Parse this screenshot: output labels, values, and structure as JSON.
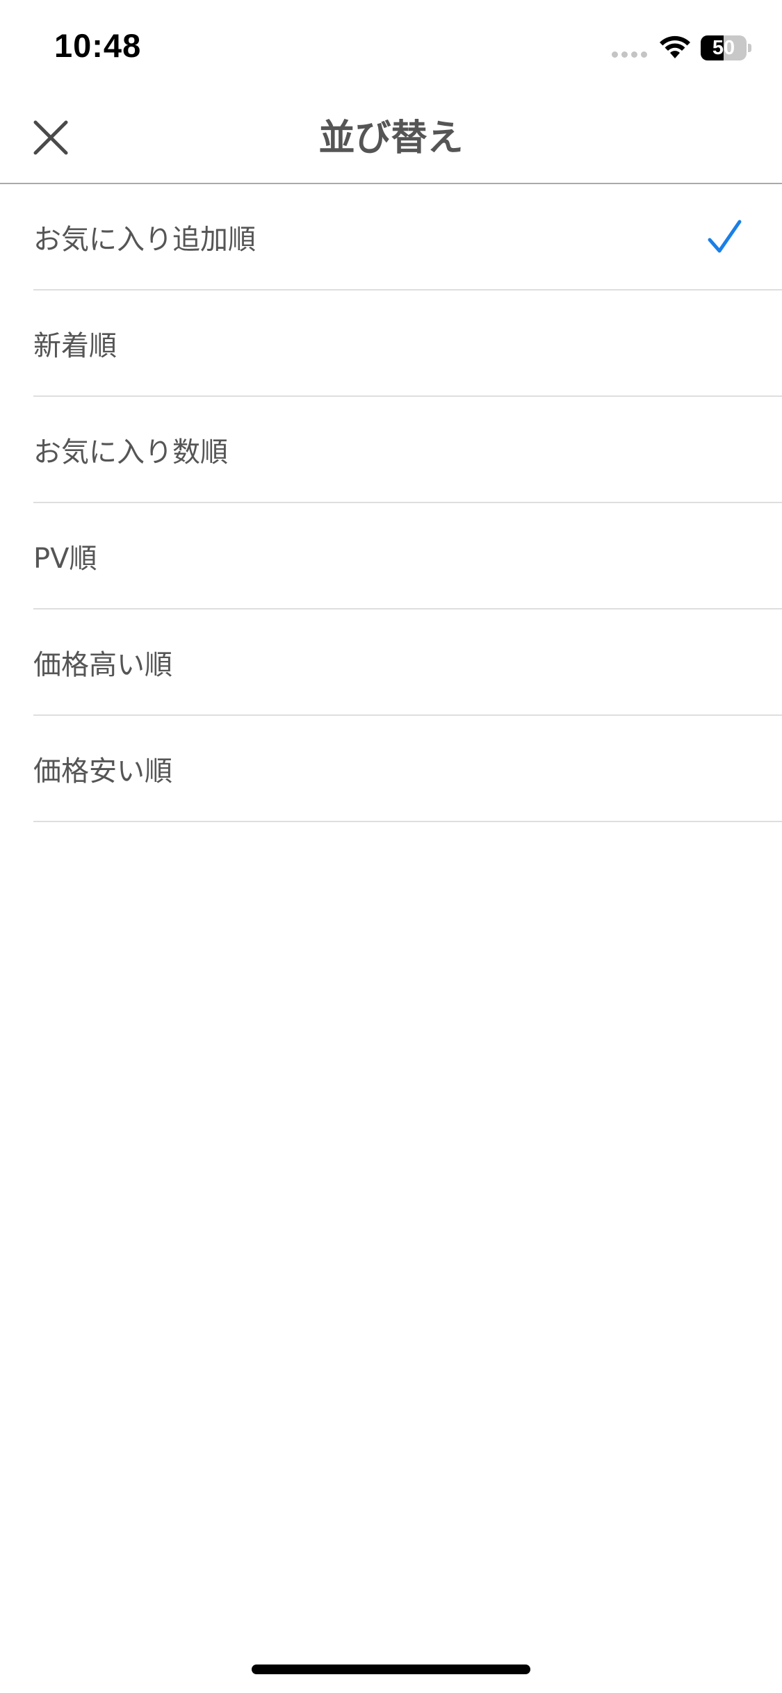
{
  "status_bar": {
    "time": "10:48",
    "battery_level": "50",
    "battery_fraction": 0.5
  },
  "header": {
    "title": "並び替え",
    "close_icon": "close-icon"
  },
  "sort_options": [
    {
      "label": "お気に入り追加順",
      "selected": true
    },
    {
      "label": "新着順",
      "selected": false
    },
    {
      "label": "お気に入り数順",
      "selected": false
    },
    {
      "label": "PV順",
      "selected": false
    },
    {
      "label": "価格高い順",
      "selected": false
    },
    {
      "label": "価格安い順",
      "selected": false
    }
  ],
  "colors": {
    "accent": "#1a7fe6",
    "text": "#555555",
    "divider": "#dedede"
  }
}
